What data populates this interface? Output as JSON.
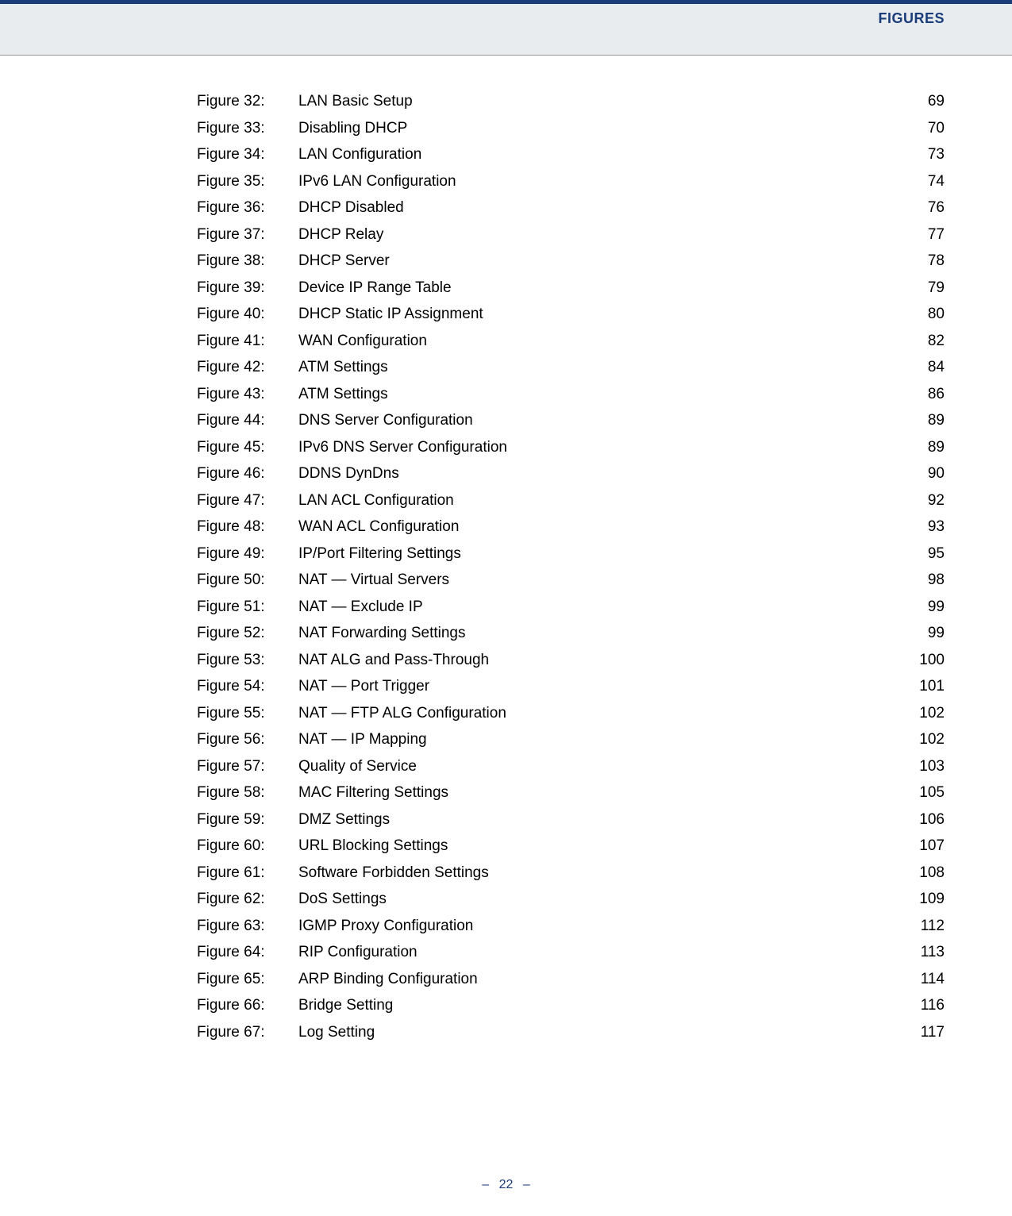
{
  "header": {
    "title": "FIGURES"
  },
  "figures": [
    {
      "label": "Figure 32:",
      "title": "LAN Basic Setup",
      "page": "69"
    },
    {
      "label": "Figure 33:",
      "title": "Disabling DHCP",
      "page": "70"
    },
    {
      "label": "Figure 34:",
      "title": "LAN Configuration",
      "page": "73"
    },
    {
      "label": "Figure 35:",
      "title": "IPv6 LAN Configuration",
      "page": "74"
    },
    {
      "label": "Figure 36:",
      "title": "DHCP Disabled",
      "page": "76"
    },
    {
      "label": "Figure 37:",
      "title": "DHCP Relay",
      "page": "77"
    },
    {
      "label": "Figure 38:",
      "title": "DHCP Server",
      "page": "78"
    },
    {
      "label": "Figure 39:",
      "title": "Device IP Range Table",
      "page": "79"
    },
    {
      "label": "Figure 40:",
      "title": "DHCP Static IP Assignment",
      "page": "80"
    },
    {
      "label": "Figure 41:",
      "title": "WAN Configuration",
      "page": "82"
    },
    {
      "label": "Figure 42:",
      "title": "ATM Settings",
      "page": "84"
    },
    {
      "label": "Figure 43:",
      "title": "ATM Settings",
      "page": "86"
    },
    {
      "label": "Figure 44:",
      "title": "DNS Server Configuration",
      "page": "89"
    },
    {
      "label": "Figure 45:",
      "title": "IPv6 DNS Server Configuration",
      "page": "89"
    },
    {
      "label": "Figure 46:",
      "title": "DDNS DynDns",
      "page": "90"
    },
    {
      "label": "Figure 47:",
      "title": "LAN ACL Configuration",
      "page": "92"
    },
    {
      "label": "Figure 48:",
      "title": "WAN ACL Configuration",
      "page": "93"
    },
    {
      "label": "Figure 49:",
      "title": "IP/Port Filtering Settings",
      "page": "95"
    },
    {
      "label": "Figure 50:",
      "title": "NAT — Virtual Servers",
      "page": "98"
    },
    {
      "label": "Figure 51:",
      "title": "NAT — Exclude IP",
      "page": "99"
    },
    {
      "label": "Figure 52:",
      "title": "NAT Forwarding Settings",
      "page": "99"
    },
    {
      "label": "Figure 53:",
      "title": "NAT ALG and Pass-Through",
      "page": "100"
    },
    {
      "label": "Figure 54:",
      "title": "NAT — Port Trigger",
      "page": "101"
    },
    {
      "label": "Figure 55:",
      "title": "NAT — FTP ALG Configuration",
      "page": "102"
    },
    {
      "label": "Figure 56:",
      "title": "NAT — IP Mapping",
      "page": "102"
    },
    {
      "label": "Figure 57:",
      "title": "Quality of Service",
      "page": "103"
    },
    {
      "label": "Figure 58:",
      "title": "MAC Filtering Settings",
      "page": "105"
    },
    {
      "label": "Figure 59:",
      "title": "DMZ Settings",
      "page": "106"
    },
    {
      "label": "Figure 60:",
      "title": "URL Blocking Settings",
      "page": "107"
    },
    {
      "label": "Figure 61:",
      "title": "Software Forbidden Settings",
      "page": "108"
    },
    {
      "label": "Figure 62:",
      "title": "DoS Settings",
      "page": "109"
    },
    {
      "label": "Figure 63:",
      "title": "IGMP Proxy Configuration",
      "page": "112"
    },
    {
      "label": "Figure 64:",
      "title": "RIP Configuration",
      "page": "113"
    },
    {
      "label": "Figure 65:",
      "title": "ARP Binding Configuration",
      "page": "114"
    },
    {
      "label": "Figure 66:",
      "title": "Bridge Setting",
      "page": "116"
    },
    {
      "label": "Figure 67:",
      "title": "Log Setting",
      "page": "117"
    }
  ],
  "footer": {
    "dash": "–",
    "page_number": "22"
  }
}
